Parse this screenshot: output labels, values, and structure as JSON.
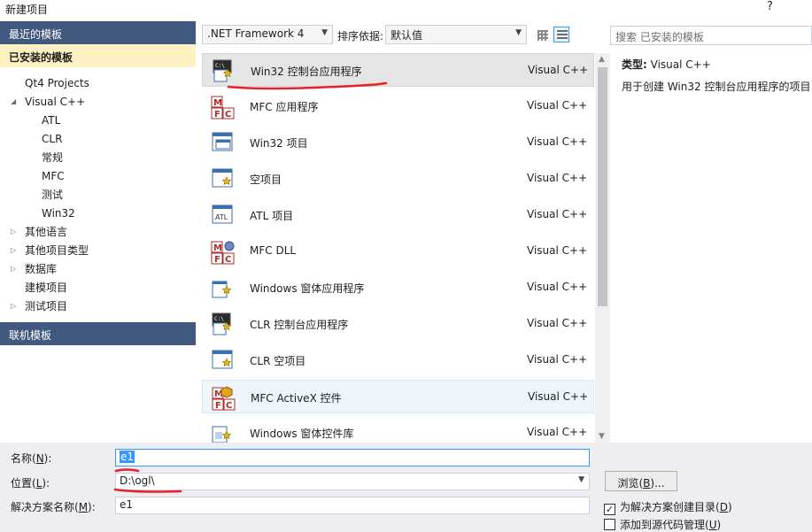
{
  "window": {
    "title": "新建项目",
    "help": "?"
  },
  "left": {
    "recent": "最近的模板",
    "installed": "已安装的模板",
    "online": "联机模板",
    "tree": [
      {
        "label": "Qt4 Projects",
        "level": 1,
        "expander": ""
      },
      {
        "label": "Visual C++",
        "level": 1,
        "expander": "◢"
      },
      {
        "label": "ATL",
        "level": 2,
        "expander": ""
      },
      {
        "label": "CLR",
        "level": 2,
        "expander": ""
      },
      {
        "label": "常规",
        "level": 2,
        "expander": ""
      },
      {
        "label": "MFC",
        "level": 2,
        "expander": ""
      },
      {
        "label": "测试",
        "level": 2,
        "expander": ""
      },
      {
        "label": "Win32",
        "level": 2,
        "expander": ""
      },
      {
        "label": "其他语言",
        "level": 1,
        "expander": "▷"
      },
      {
        "label": "其他项目类型",
        "level": 1,
        "expander": "▷"
      },
      {
        "label": "数据库",
        "level": 1,
        "expander": "▷"
      },
      {
        "label": "建模项目",
        "level": 1,
        "expander": ""
      },
      {
        "label": "测试项目",
        "level": 1,
        "expander": "▷"
      }
    ]
  },
  "toolbar": {
    "framework": ".NET Framework 4",
    "sort_label": "排序依据:",
    "sort_value": "默认值"
  },
  "search": {
    "placeholder": "搜索 已安装的模板"
  },
  "templates": [
    {
      "name": "Win32 控制台应用程序",
      "lang": "Visual C++",
      "icon": "console-app-icon",
      "state": "selected"
    },
    {
      "name": "MFC 应用程序",
      "lang": "Visual C++",
      "icon": "mfc-icon",
      "state": ""
    },
    {
      "name": "Win32 项目",
      "lang": "Visual C++",
      "icon": "window-icon",
      "state": ""
    },
    {
      "name": "空项目",
      "lang": "Visual C++",
      "icon": "empty-project-icon",
      "state": ""
    },
    {
      "name": "ATL 项目",
      "lang": "Visual C++",
      "icon": "atl-icon",
      "state": ""
    },
    {
      "name": "MFC DLL",
      "lang": "Visual C++",
      "icon": "mfc-dll-icon",
      "state": ""
    },
    {
      "name": "Windows 窗体应用程序",
      "lang": "Visual C++",
      "icon": "forms-app-icon",
      "state": ""
    },
    {
      "name": "CLR 控制台应用程序",
      "lang": "Visual C++",
      "icon": "clr-console-icon",
      "state": ""
    },
    {
      "name": "CLR 空项目",
      "lang": "Visual C++",
      "icon": "clr-empty-icon",
      "state": ""
    },
    {
      "name": "MFC ActiveX 控件",
      "lang": "Visual C++",
      "icon": "mfc-activex-icon",
      "state": "hover"
    },
    {
      "name": "Windows 窗体控件库",
      "lang": "Visual C++",
      "icon": "forms-control-icon",
      "state": ""
    }
  ],
  "detail": {
    "type_label": "类型:",
    "type_value": "Visual C++",
    "description": "用于创建 Win32 控制台应用程序的项目"
  },
  "form": {
    "name_label_pre": "名称(",
    "name_key": "N",
    "name_label_post": "):",
    "name_value": "e1",
    "location_label_pre": "位置(",
    "location_key": "L",
    "location_label_post": "):",
    "location_value": "D:\\ogl\\",
    "solution_label_pre": "解决方案名称(",
    "solution_key": "M",
    "solution_label_post": "):",
    "solution_value": "e1",
    "browse_pre": "浏览(",
    "browse_key": "B",
    "browse_post": ")...",
    "create_dir_pre": "为解决方案创建目录(",
    "create_dir_key": "D",
    "create_dir_post": ")",
    "create_dir_checked": true,
    "source_control_pre": "添加到源代码管理(",
    "source_control_key": "U",
    "source_control_post": ")",
    "source_control_checked": false
  },
  "colors": {
    "header_bg": "#42597f",
    "selected_bg": "#fef2c2",
    "accent": "#3399ff",
    "annotation": "#e8202a"
  }
}
